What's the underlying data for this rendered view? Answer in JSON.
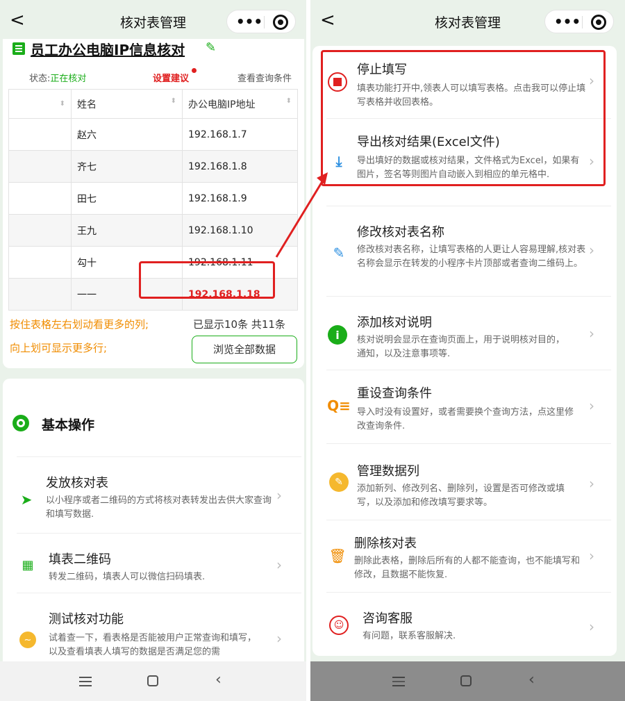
{
  "left": {
    "nav": {
      "back": "<",
      "title": "核对表管理",
      "menu": "•••"
    },
    "sheet_title": "员工办公电脑IP信息核对",
    "status_label": "状态:",
    "status_value": "正在核对",
    "suggest": "设置建议",
    "query_cond": "查看查询条件",
    "table": {
      "headers": [
        "",
        "姓名",
        "办公电脑IP地址"
      ],
      "rows": [
        [
          "赵六",
          "192.168.1.7"
        ],
        [
          "齐七",
          "192.168.1.8"
        ],
        [
          "田七",
          "192.168.1.9"
        ],
        [
          "王九",
          "192.168.1.10"
        ],
        [
          "勾十",
          "192.168.1.11"
        ],
        [
          "一一",
          "192.168.1.18"
        ]
      ]
    },
    "hint1": "按住表格左右划动看更多的列;",
    "hint2": "向上划可显示更多行;",
    "count": "已显示10条 共11条",
    "browse_btn": "浏览全部数据",
    "basic_title": "基本操作",
    "items": [
      {
        "title": "发放核对表",
        "desc": "以小程序或者二维码的方式将核对表转发出去供大家查询和填写数据."
      },
      {
        "title": "填表二维码",
        "desc": "转发二维码，填表人可以微信扫码填表."
      },
      {
        "title": "测试核对功能",
        "desc": "试着查一下，看表格是否能被用户正常查询和填写，以及查看填表人填写的数据是否满足您的需"
      }
    ]
  },
  "right": {
    "nav": {
      "back": "<",
      "title": "核对表管理",
      "menu": "•••"
    },
    "items": [
      {
        "title": "停止填写",
        "desc": "填表功能打开中,领表人可以填写表格。点击我可以停止填写表格并收回表格。"
      },
      {
        "title": "导出核对结果(Excel文件)",
        "desc": "导出填好的数据或核对结果，文件格式为Excel，如果有图片，签名等则图片自动嵌入到相应的单元格中."
      },
      {
        "title": "修改核对表名称",
        "desc": "修改核对表名称，让填写表格的人更让人容易理解,核对表名称会显示在转发的小程序卡片顶部或者查询二维码上。"
      },
      {
        "title": "添加核对说明",
        "desc": "核对说明会显示在查询页面上，用于说明核对目的，通知，以及注意事项等."
      },
      {
        "title": "重设查询条件",
        "desc": "导入时没有设置好，或者需要换个查询方法，点这里修改查询条件."
      },
      {
        "title": "管理数据列",
        "desc": "添加新列、修改列名、删除列，设置是否可修改或填写，以及添加和修改填写要求等。"
      },
      {
        "title": "删除核对表",
        "desc": "删除此表格，删除后所有的人都不能查询，也不能填写和修改，且数据不能恢复."
      },
      {
        "title": "咨询客服",
        "desc": "有问题，联系客服解决."
      }
    ]
  },
  "colors": {
    "green": "#1aad19",
    "red": "#e02020",
    "orange": "#f08c00",
    "yellow": "#f5b82e"
  }
}
